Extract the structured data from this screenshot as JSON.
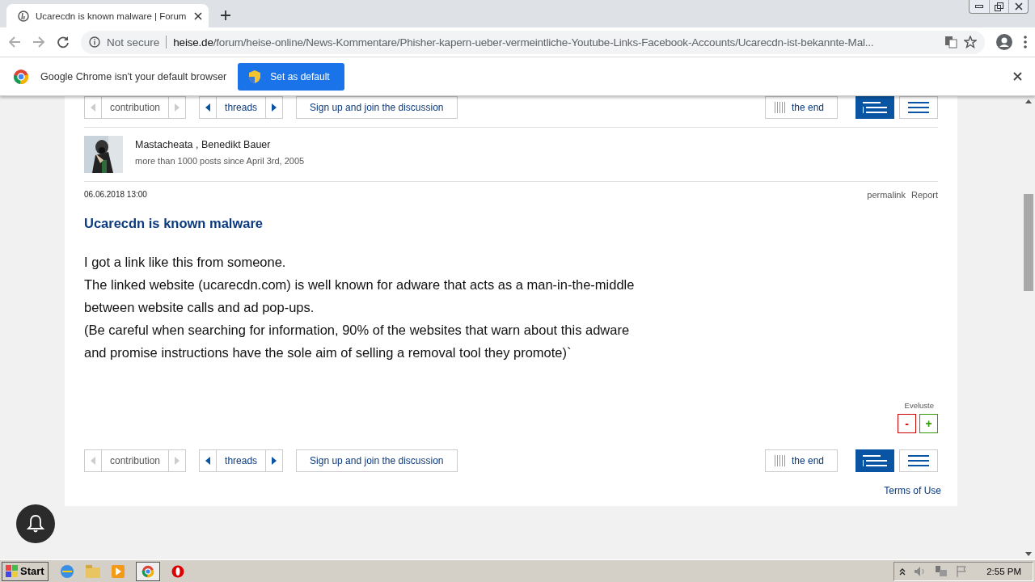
{
  "browser": {
    "tab": {
      "title": "Ucarecdn is known malware | Forum"
    },
    "address": {
      "security": "Not secure",
      "domain": "heise.de",
      "path": "/forum/heise-online/News-Kommentare/Phisher-kapern-ueber-vermeintliche-Youtube-Links-Facebook-Accounts/Ucarecdn-ist-bekannte-Mal..."
    }
  },
  "infobar": {
    "message": "Google Chrome isn't your default browser",
    "button": "Set as default"
  },
  "nav_bars": [
    {
      "groups": [
        {
          "label": "contribution",
          "disabled": true
        },
        {
          "label": "threads",
          "disabled": false
        }
      ],
      "signup": "Sign up and join the discussion",
      "end": "the end",
      "views": [
        {
          "selected": true
        },
        {
          "selected": false
        }
      ]
    },
    {
      "groups": [
        {
          "label": "contribution",
          "disabled": true
        },
        {
          "label": "threads",
          "disabled": false
        }
      ],
      "signup": "Sign up and join the discussion",
      "end": "the end",
      "views": [
        {
          "selected": true
        },
        {
          "selected": false
        }
      ]
    }
  ],
  "post": {
    "author": "Mastacheata , Benedikt Bauer",
    "stats": "more than 1000 posts since April 3rd, 2005",
    "date": "06.06.2018 13:00",
    "actions": [
      "permalink",
      "Report"
    ],
    "title": "Ucarecdn is known malware",
    "lines": [
      "I got a link like this from someone.",
      "The linked website (ucarecdn.com) is well known for adware that acts as a man-in-the-middle",
      "between website calls and ad pop-ups.",
      "(Be careful when searching for information, 90% of the websites that warn about this adware",
      "and promise instructions have the sole aim of selling a removal tool they promote)`"
    ],
    "evaluate": {
      "label": "Eveluste",
      "minus": "-",
      "plus": "+"
    }
  },
  "footer": {
    "link": "Terms of Use"
  },
  "taskbar": {
    "start": "Start",
    "clock": "2:55 PM"
  }
}
